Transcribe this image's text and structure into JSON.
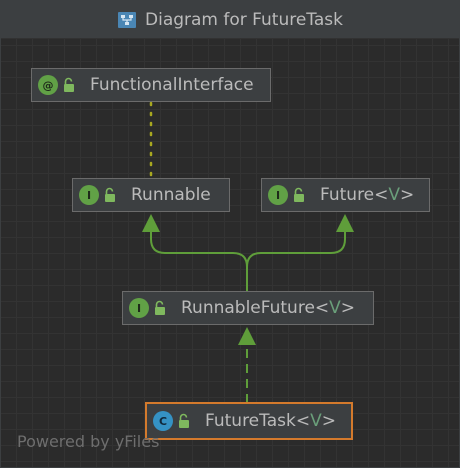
{
  "window": {
    "title": "Diagram for FutureTask"
  },
  "nodes": {
    "functional_interface": {
      "badge": "@",
      "name": "FunctionalInterface"
    },
    "runnable": {
      "badge": "I",
      "name": "Runnable"
    },
    "future": {
      "badge": "I",
      "name": "Future",
      "type_param": "V"
    },
    "runnable_future": {
      "badge": "I",
      "name": "RunnableFuture",
      "type_param": "V"
    },
    "future_task": {
      "badge": "C",
      "name": "FutureTask",
      "type_param": "V"
    }
  },
  "watermark": "Powered by yFiles",
  "colors": {
    "background": "#2b2b2b",
    "node_fill": "#3c3f41",
    "node_border": "#6b6b6b",
    "selected_border": "#d47a2c",
    "edge": "#5f9e3a",
    "annotation_link": "#a8a820",
    "interface_badge": "#61a146",
    "class_badge": "#3592c4"
  },
  "icons": {
    "title": "class-diagram-icon",
    "visibility": "public-lock-icon"
  }
}
